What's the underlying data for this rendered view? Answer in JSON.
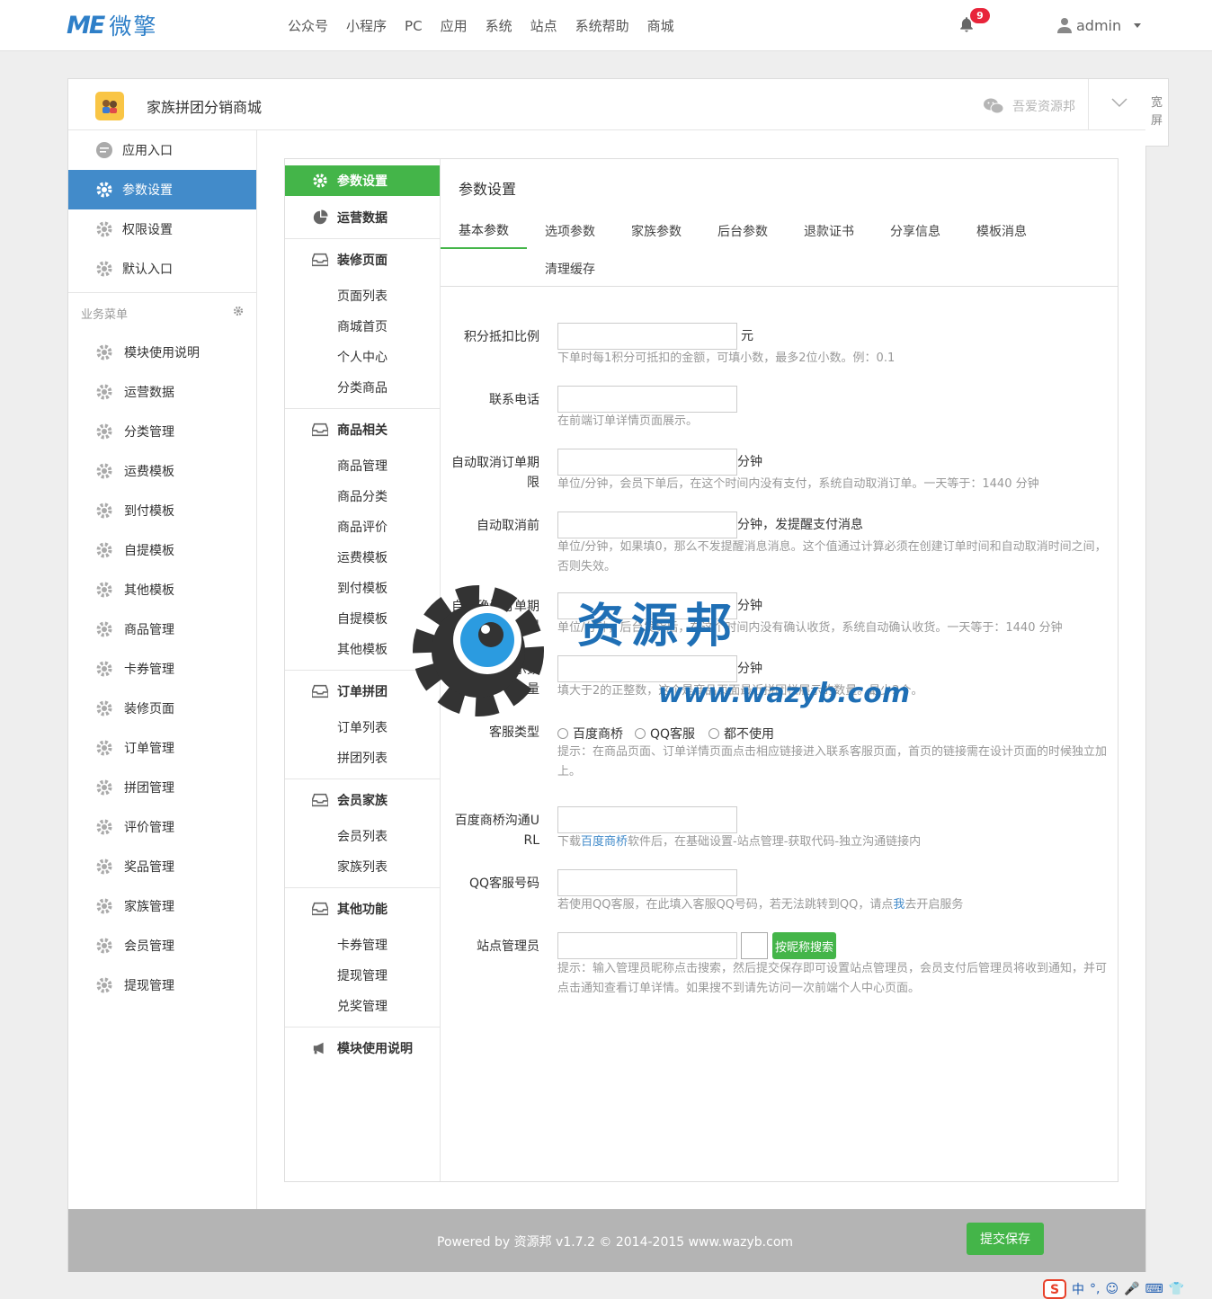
{
  "topbar": {
    "logo_me": "ME",
    "logo_text": "微擎",
    "nav": [
      "公众号",
      "小程序",
      "PC",
      "应用",
      "系统",
      "站点",
      "系统帮助",
      "商城"
    ],
    "notifications": "9",
    "username": "admin"
  },
  "app": {
    "title": "家族拼团分销商城",
    "wechat_account": "吾爱资源邦",
    "wide_label_1": "宽",
    "wide_label_2": "屏"
  },
  "sidebar": {
    "items": [
      "应用入口",
      "参数设置",
      "权限设置",
      "默认入口"
    ],
    "group_label": "业务菜单",
    "business": [
      "模块使用说明",
      "运营数据",
      "分类管理",
      "运费模板",
      "到付模板",
      "自提模板",
      "其他模板",
      "商品管理",
      "卡券管理",
      "装修页面",
      "订单管理",
      "拼团管理",
      "评价管理",
      "奖品管理",
      "家族管理",
      "会员管理",
      "提现管理"
    ]
  },
  "subnav": {
    "settings": "参数设置",
    "ops": "运营数据",
    "decorate": "装修页面",
    "decorate_items": [
      "页面列表",
      "商城首页",
      "个人中心",
      "分类商品"
    ],
    "goods": "商品相关",
    "goods_items": [
      "商品管理",
      "商品分类",
      "商品评价",
      "运费模板",
      "到付模板",
      "自提模板",
      "其他模板"
    ],
    "orders": "订单拼团",
    "orders_items": [
      "订单列表",
      "拼团列表"
    ],
    "members": "会员家族",
    "members_items": [
      "会员列表",
      "家族列表"
    ],
    "other": "其他功能",
    "other_items": [
      "卡券管理",
      "提现管理",
      "兑奖管理"
    ],
    "manual": "模块使用说明"
  },
  "form": {
    "title": "参数设置",
    "tabs": [
      "基本参数",
      "选项参数",
      "家族参数",
      "后台参数",
      "退款证书",
      "分享信息",
      "模板消息",
      "清理缓存"
    ],
    "points_label": "积分抵扣比例",
    "points_unit": "元",
    "points_help": "下单时每1积分可抵扣的金额，可填小数，最多2位小数。例：0.1",
    "phone_label": "联系电话",
    "phone_help": "在前端订单详情页面展示。",
    "autocancel_label_1": "自动取消订单期",
    "autocancel_label_2": "限",
    "autocancel_unit": "分钟",
    "autocancel_help": "单位/分钟，会员下单后，在这个时间内没有支付，系统自动取消订单。一天等于：1440 分钟",
    "remind_label": "自动取消前",
    "remind_unit": "分钟，发提醒支付消息",
    "remind_help_1": "单位/分钟，如果填0，那么不发提醒消息消息。这个值通过计算必须在创建订单时间和自动取消时间之间，",
    "remind_help_2": "否则失效。",
    "confirm_label_1": "自动确认订单期",
    "confirm_label_2": "限",
    "confirm_unit": "分钟",
    "confirm_help": "单位/分钟，后台发货后，在这个时间内没有确认收货，系统自动确认收货。一天等于：1440 分钟",
    "recent_label_1": "最近拼团显示数",
    "recent_label_2": "量",
    "recent_unit": "分钟",
    "recent_help": "填大于2的正整数，这个是商品页面最近拼团栏展示的数量。最少2个。",
    "service_label": "客服类型",
    "service_options": [
      "百度商桥",
      "QQ客服",
      "都不使用"
    ],
    "service_help_1": "提示：在商品页面、订单详情页面点击相应链接进入联系客服页面，首页的链接需在设计页面的时候独立加",
    "service_help_2": "上。",
    "baidu_label_1": "百度商桥沟通U",
    "baidu_label_2": "RL",
    "baidu_help_pre": "下载",
    "baidu_help_link": "百度商桥",
    "baidu_help_post": "软件后，在基础设置-站点管理-获取代码-独立沟通链接内",
    "qq_label": "QQ客服号码",
    "qq_help_pre": "若使用QQ客服，在此填入客服QQ号码，若无法跳转到QQ，请点",
    "qq_help_link": "我",
    "qq_help_post": "去开启服务",
    "admin_label": "站点管理员",
    "admin_search": "按昵称搜索",
    "admin_help_1": "提示：输入管理员昵称点击搜索，然后提交保存即可设置站点管理员，会员支付后管理员将收到通知，并可",
    "admin_help_2": "点击通知查看订单详情。如果搜不到请先访问一次前端个人中心页面。"
  },
  "footer": {
    "powered": "Powered by 资源邦 v1.7.2 © 2014-2015 www.wazyb.com",
    "save": "提交保存"
  },
  "watermark": {
    "text": "资源邦",
    "url": "www.wazyb.com"
  },
  "ime": [
    "中",
    "°,",
    "☺",
    "🎤",
    "⌨",
    "👕"
  ],
  "colors": {
    "brand_blue": "#2e7fc8",
    "active_blue": "#428bca",
    "green": "#44b549",
    "badge_red": "#e8243a"
  }
}
